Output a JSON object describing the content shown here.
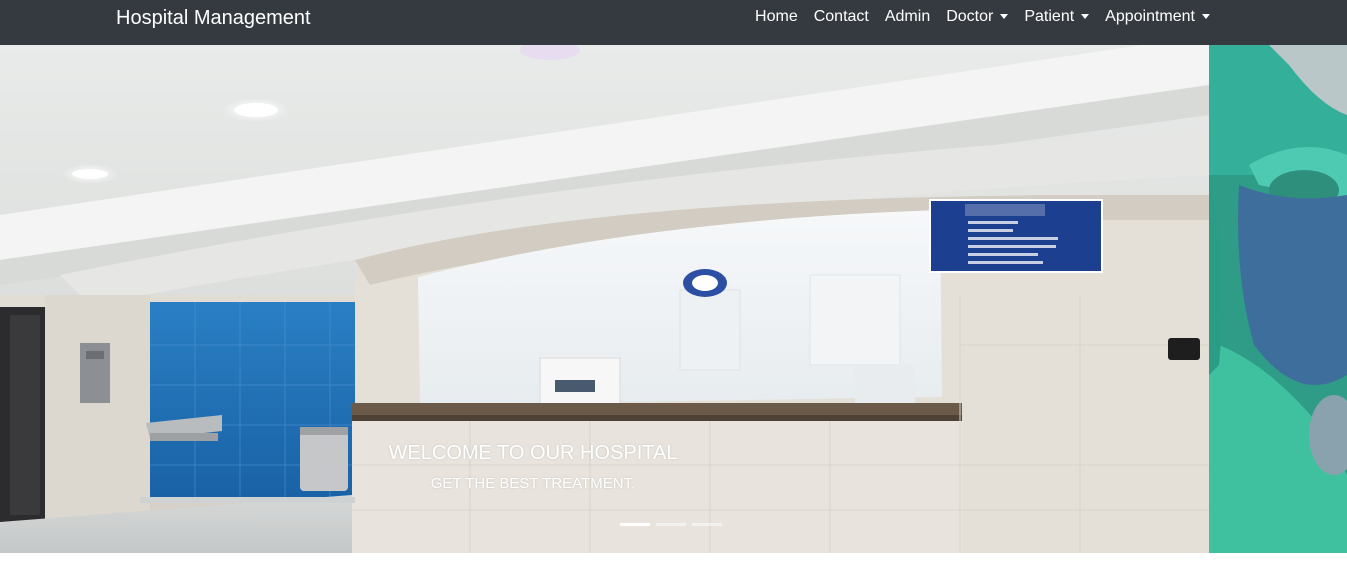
{
  "navbar": {
    "brand": "Hospital Management",
    "items": [
      {
        "label": "Home",
        "dropdown": false
      },
      {
        "label": "Contact",
        "dropdown": false
      },
      {
        "label": "Admin",
        "dropdown": false
      },
      {
        "label": "Doctor",
        "dropdown": true
      },
      {
        "label": "Patient",
        "dropdown": true
      },
      {
        "label": "Appointment",
        "dropdown": true
      }
    ]
  },
  "carousel": {
    "caption_title": "WELCOME TO OUR HOSPITAL",
    "caption_subtitle": "GET THE BEST TREATMENT.",
    "slide_count": 3,
    "active_index": 0
  },
  "colors": {
    "navbar_bg": "#343a40",
    "nav_text": "#ffffff",
    "wall_blue": "#1f6fb8"
  },
  "icons": {
    "dropdown": "caret-down-icon"
  }
}
